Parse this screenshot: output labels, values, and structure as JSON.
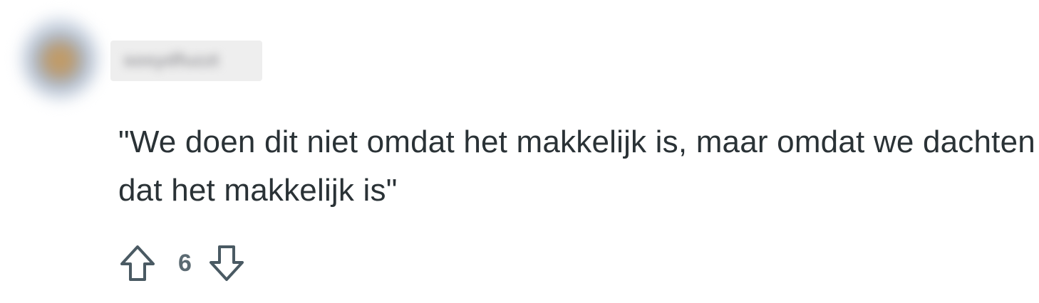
{
  "comment": {
    "author": "sosydfuzzt",
    "text": "\"We doen dit niet omdat het makkelijk is, maar omdat we dachten dat het makkelijk is\"",
    "score": "6",
    "icons": {
      "upvote": "arrow-up-outline-icon",
      "downvote": "arrow-down-outline-icon"
    },
    "colors": {
      "text": "#2a3236",
      "score": "#5b6a72",
      "icon_stroke": "#4a5a63"
    }
  }
}
